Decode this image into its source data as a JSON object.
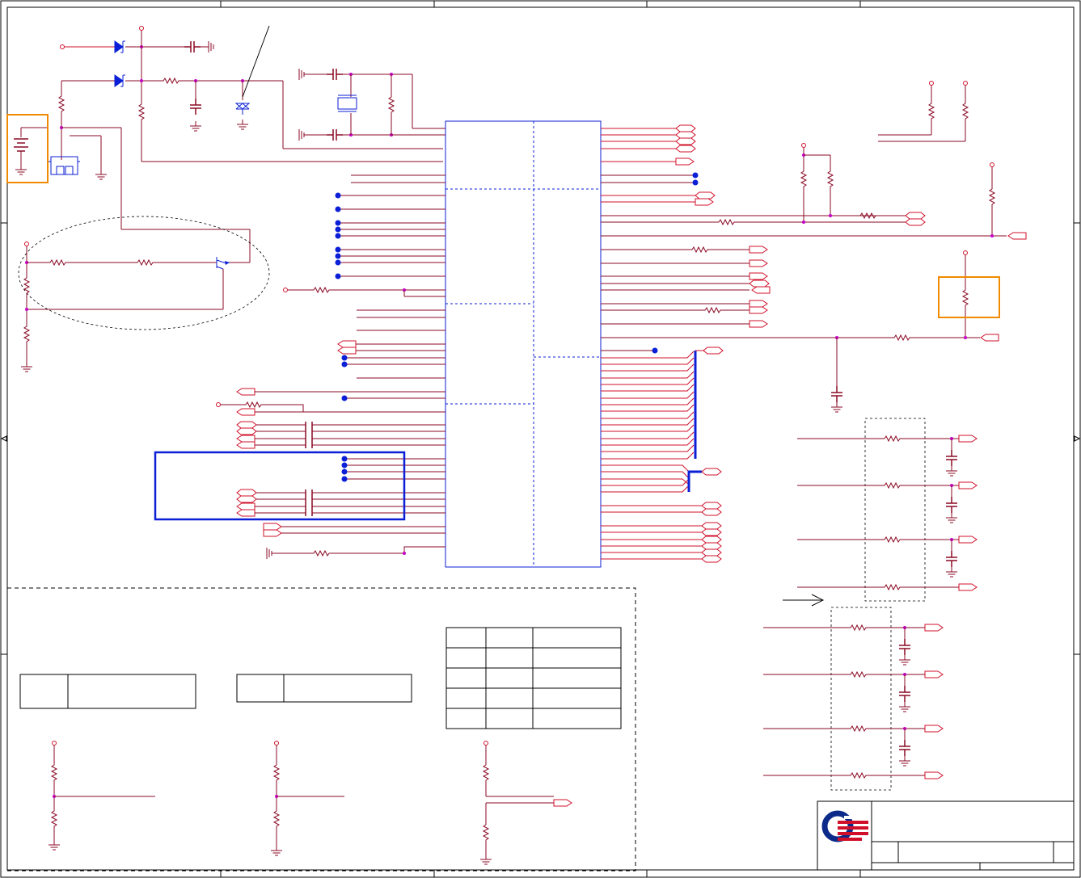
{
  "diagram": {
    "kind": "electronic-schematic",
    "colors": {
      "wire": "#8b0a24",
      "net": "#d0102a",
      "ic_outline": "#0b1fd6",
      "junction": "#c400c4",
      "highlight_orange": "#f08a00",
      "highlight_blue": "#0b1fd6"
    },
    "regions": {
      "battery_highlight": "orange-box",
      "pullup_highlight": "orange-box",
      "bus_group_highlight": "blue-box",
      "transistor_group": "dashed-ellipse",
      "config_area": "dashed-box"
    },
    "title_block": {
      "logo_icon": "quanta-logo-icon"
    },
    "tables": {
      "config_table": {
        "rows": 5,
        "cols": 3
      },
      "small_table_left": {
        "rows": 1,
        "cols": 2
      },
      "small_table_right": {
        "rows": 1,
        "cols": 2
      }
    }
  }
}
